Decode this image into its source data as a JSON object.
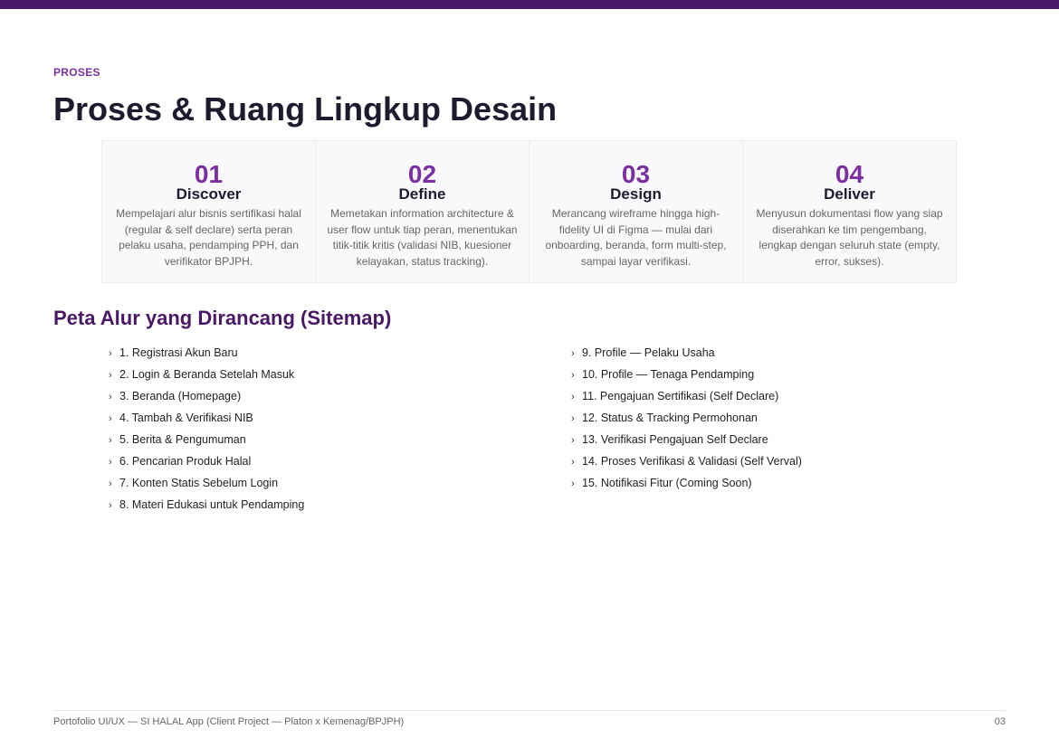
{
  "header": {
    "eyebrow": "PROSES",
    "title": "Proses & Ruang Lingkup Desain"
  },
  "steps": [
    {
      "number": "01",
      "title": "Discover",
      "description": "Mempelajari alur bisnis sertifikasi halal (regular & self declare) serta peran pelaku usaha, pendamping PPH, dan verifikator BPJPH."
    },
    {
      "number": "02",
      "title": "Define",
      "description": "Memetakan information architecture & user flow untuk tiap peran, menentukan titik-titik kritis (validasi NIB, kuesioner kelayakan, status tracking)."
    },
    {
      "number": "03",
      "title": "Design",
      "description": "Merancang wireframe hingga high-fidelity UI di Figma — mulai dari onboarding, beranda, form multi-step, sampai layar verifikasi."
    },
    {
      "number": "04",
      "title": "Deliver",
      "description": "Menyusun dokumentasi flow yang siap diserahkan ke tim pengembang, lengkap dengan seluruh state (empty, error, sukses)."
    }
  ],
  "sitemap": {
    "title": "Peta Alur yang Dirancang (Sitemap)",
    "bullet": "›",
    "left": [
      "1. Registrasi Akun Baru",
      "2. Login & Beranda Setelah Masuk",
      "3. Beranda (Homepage)",
      "4. Tambah & Verifikasi NIB",
      "5. Berita & Pengumuman",
      "6. Pencarian Produk Halal",
      "7. Konten Statis Sebelum Login",
      "8. Materi Edukasi untuk Pendamping"
    ],
    "right": [
      "9. Profile — Pelaku Usaha",
      "10. Profile — Tenaga Pendamping",
      "11. Pengajuan Sertifikasi (Self Declare)",
      "12. Status & Tracking Permohonan",
      "13. Verifikasi Pengajuan Self Declare",
      "14. Proses Verifikasi & Validasi (Self Verval)",
      "15. Notifikasi Fitur (Coming Soon)"
    ]
  },
  "footer": {
    "left": "Portofolio UI/UX — SI HALAL App (Client Project — Platon x Kemenag/BPJPH)",
    "page": "03"
  },
  "colors": {
    "accent": "#7b2fa0",
    "brand_dark": "#4a1866",
    "title": "#1f1a2e"
  }
}
